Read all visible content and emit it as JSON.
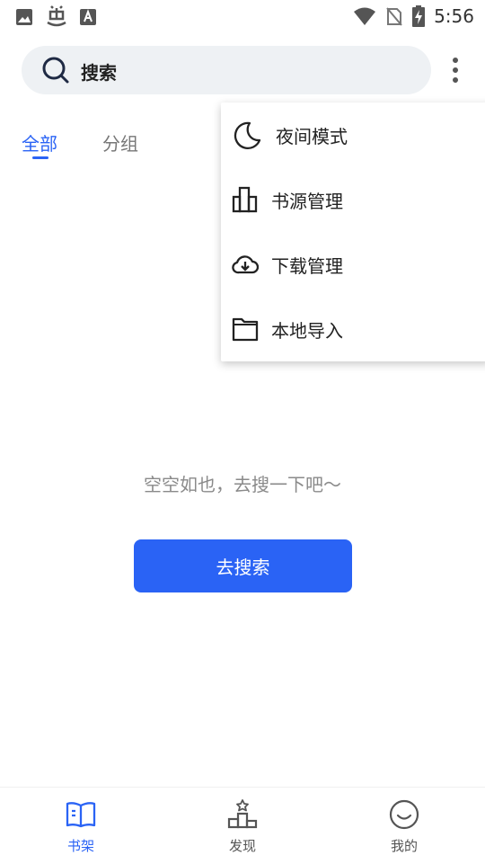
{
  "status_bar": {
    "time": "5:56",
    "left_icons": [
      "image-icon",
      "bug-icon",
      "text-a-icon"
    ],
    "right_icons": [
      "wifi-icon",
      "no-sim-icon",
      "battery-charging-icon"
    ]
  },
  "search": {
    "label": "搜索"
  },
  "tabs": [
    {
      "label": "全部",
      "active": true
    },
    {
      "label": "分组",
      "active": false
    }
  ],
  "menu": {
    "items": [
      {
        "label": "夜间模式",
        "icon": "moon-icon"
      },
      {
        "label": "书源管理",
        "icon": "book-source-icon"
      },
      {
        "label": "下载管理",
        "icon": "cloud-download-icon"
      },
      {
        "label": "本地导入",
        "icon": "folder-icon"
      }
    ]
  },
  "empty_state": {
    "message": "空空如也，去搜一下吧～",
    "button_label": "去搜索"
  },
  "bottom_nav": {
    "items": [
      {
        "label": "书架",
        "icon": "bookshelf-icon",
        "active": true
      },
      {
        "label": "发现",
        "icon": "discover-icon",
        "active": false
      },
      {
        "label": "我的",
        "icon": "profile-icon",
        "active": false
      }
    ]
  },
  "colors": {
    "accent": "#2a63f5",
    "search_bg": "#eef1f4",
    "muted_text": "#8a8a8a"
  }
}
